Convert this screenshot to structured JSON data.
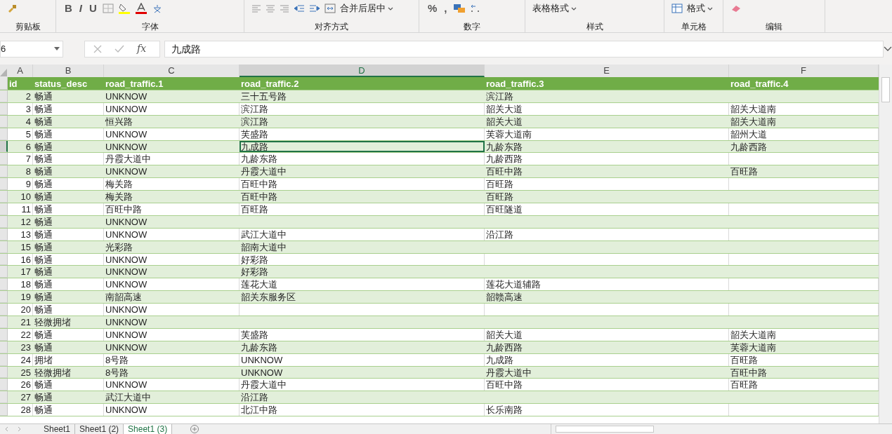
{
  "ribbon": {
    "groups": [
      {
        "label": "剪贴板"
      },
      {
        "label": "字体",
        "tools": [
          {
            "kind": "glyph",
            "text": "B"
          },
          {
            "kind": "glyph",
            "text": "I"
          },
          {
            "kind": "glyph",
            "text": "U"
          }
        ]
      },
      {
        "label": "对齐方式",
        "tools": [
          {
            "kind": "dropdown",
            "text": "合并后居中"
          }
        ]
      },
      {
        "label": "数字",
        "tools": [
          {
            "kind": "glyph",
            "text": "%"
          },
          {
            "kind": "glyph",
            "text": ","
          }
        ]
      },
      {
        "label": "样式",
        "tools": [
          {
            "kind": "dropdown",
            "text": "表格格式"
          }
        ]
      },
      {
        "label": "单元格",
        "tools": [
          {
            "kind": "dropdown",
            "text": "格式"
          }
        ]
      },
      {
        "label": "编辑"
      }
    ]
  },
  "formula_bar": {
    "name_box": "6",
    "function_label": "fx",
    "value": "九成路"
  },
  "columns": [
    {
      "letter": "A",
      "selected": false
    },
    {
      "letter": "B",
      "selected": false
    },
    {
      "letter": "C",
      "selected": false
    },
    {
      "letter": "D",
      "selected": true
    },
    {
      "letter": "E",
      "selected": false
    },
    {
      "letter": "F",
      "selected": false
    }
  ],
  "header": [
    "id",
    "status_desc",
    "road_traffic.1",
    "road_traffic.2",
    "road_traffic.3",
    "road_traffic.4"
  ],
  "rows": [
    {
      "selected": false,
      "cells": {
        "a": "2",
        "b": "畅通",
        "c": "UNKNOW",
        "d": "三十五号路",
        "e": "滨江路"
      }
    },
    {
      "selected": false,
      "cells": {
        "a": "3",
        "b": "畅通",
        "c": "UNKNOW",
        "d": "滨江路",
        "e": "韶关大道",
        "f": "韶关大道南"
      }
    },
    {
      "selected": false,
      "cells": {
        "a": "4",
        "b": "畅通",
        "c": "恒兴路",
        "d": "滨江路",
        "e": "韶关大道",
        "f": "韶关大道南"
      }
    },
    {
      "selected": false,
      "cells": {
        "a": "5",
        "b": "畅通",
        "c": "UNKNOW",
        "d": "芙盛路",
        "e": "芙蓉大道南",
        "f": "韶州大道"
      }
    },
    {
      "selected": true,
      "cells": {
        "a": "6",
        "b": "畅通",
        "c": "UNKNOW",
        "d": "九成路",
        "e": "九龄东路",
        "f": "九龄西路"
      }
    },
    {
      "selected": false,
      "cells": {
        "a": "7",
        "b": "畅通",
        "c": "丹霞大道中",
        "d": "九龄东路",
        "e": "九龄西路"
      }
    },
    {
      "selected": false,
      "cells": {
        "a": "8",
        "b": "畅通",
        "c": "UNKNOW",
        "d": "丹霞大道中",
        "e": "百旺中路",
        "f": "百旺路"
      }
    },
    {
      "selected": false,
      "cells": {
        "a": "9",
        "b": "畅通",
        "c": "梅关路",
        "d": "百旺中路",
        "e": "百旺路"
      }
    },
    {
      "selected": false,
      "cells": {
        "a": "10",
        "b": "畅通",
        "c": "梅关路",
        "d": "百旺中路",
        "e": "百旺路"
      }
    },
    {
      "selected": false,
      "cells": {
        "a": "11",
        "b": "畅通",
        "c": "百旺中路",
        "d": "百旺路",
        "e": "百旺隧道"
      }
    },
    {
      "selected": false,
      "cells": {
        "a": "12",
        "b": "畅通",
        "c": "UNKNOW"
      }
    },
    {
      "selected": false,
      "cells": {
        "a": "13",
        "b": "畅通",
        "c": "UNKNOW",
        "d": "武江大道中",
        "e": "沿江路"
      }
    },
    {
      "selected": false,
      "cells": {
        "a": "15",
        "b": "畅通",
        "c": "光彩路",
        "d": "韶南大道中"
      }
    },
    {
      "selected": false,
      "cells": {
        "a": "16",
        "b": "畅通",
        "c": "UNKNOW",
        "d": "好彩路"
      }
    },
    {
      "selected": false,
      "cells": {
        "a": "17",
        "b": "畅通",
        "c": "UNKNOW",
        "d": "好彩路"
      }
    },
    {
      "selected": false,
      "cells": {
        "a": "18",
        "b": "畅通",
        "c": "UNKNOW",
        "d": "莲花大道",
        "e": "莲花大道辅路"
      }
    },
    {
      "selected": false,
      "cells": {
        "a": "19",
        "b": "畅通",
        "c": "南韶高速",
        "d": "韶关东服务区",
        "e": "韶赣高速"
      }
    },
    {
      "selected": false,
      "cells": {
        "a": "20",
        "b": "畅通",
        "c": "UNKNOW"
      }
    },
    {
      "selected": false,
      "cells": {
        "a": "21",
        "b": "轻微拥堵",
        "c": "UNKNOW"
      }
    },
    {
      "selected": false,
      "cells": {
        "a": "22",
        "b": "畅通",
        "c": "UNKNOW",
        "d": "芙盛路",
        "e": "韶关大道",
        "f": "韶关大道南"
      }
    },
    {
      "selected": false,
      "cells": {
        "a": "23",
        "b": "畅通",
        "c": "UNKNOW",
        "d": "九龄东路",
        "e": "九龄西路",
        "f": "芙蓉大道南"
      }
    },
    {
      "selected": false,
      "cells": {
        "a": "24",
        "b": "拥堵",
        "c": "8号路",
        "d": "UNKNOW",
        "e": "九成路",
        "f": "百旺路"
      }
    },
    {
      "selected": false,
      "cells": {
        "a": "25",
        "b": "轻微拥堵",
        "c": "8号路",
        "d": "UNKNOW",
        "e": "丹霞大道中",
        "f": "百旺中路"
      }
    },
    {
      "selected": false,
      "cells": {
        "a": "26",
        "b": "畅通",
        "c": "UNKNOW",
        "d": "丹霞大道中",
        "e": "百旺中路",
        "f": "百旺路"
      }
    },
    {
      "selected": false,
      "cells": {
        "a": "27",
        "b": "畅通",
        "c": "武江大道中",
        "d": "沿江路"
      }
    },
    {
      "selected": false,
      "cells": {
        "a": "28",
        "b": "畅通",
        "c": "UNKNOW",
        "d": "北江中路",
        "e": "长乐南路"
      }
    }
  ],
  "sheet_tabs": [
    {
      "label": "Sheet1",
      "selected": false
    },
    {
      "label": "Sheet1 (2)",
      "selected": false
    },
    {
      "label": "Sheet1 (3)",
      "selected": true
    }
  ]
}
